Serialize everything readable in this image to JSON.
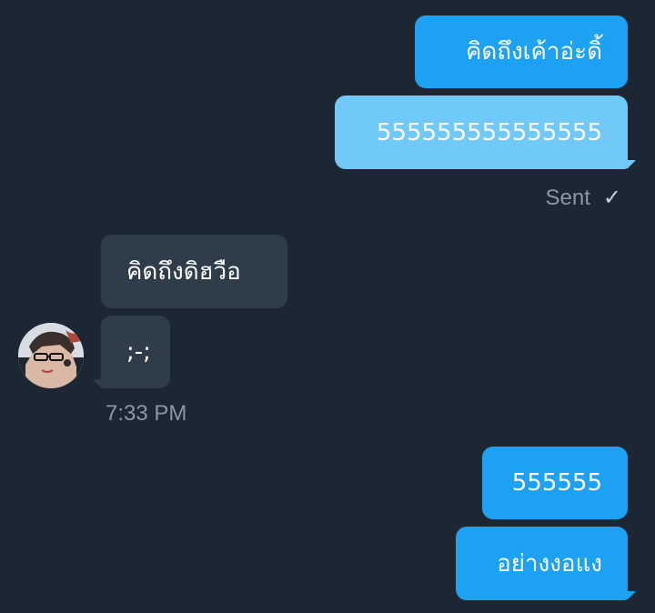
{
  "messages": {
    "m1": "คิดถึงเค้าอ่ะดิ้",
    "m2": "555555555555555",
    "m3": "คิดถึงดิฮวือ",
    "m4": ";-;",
    "m5": "555555",
    "m6": "อย่างงอแง"
  },
  "status": {
    "sent_label": "Sent",
    "sent_icon": "checkmark-icon",
    "check_glyph": "✓"
  },
  "timestamps": {
    "incoming_time": "7:33 PM"
  },
  "contact": {
    "avatar_icon": "avatar"
  },
  "colors": {
    "background": "#1c2733",
    "outgoing_primary": "#1da1f2",
    "outgoing_light": "#71c9f8",
    "incoming": "#2f3d4b",
    "meta_text": "#8899a6"
  }
}
